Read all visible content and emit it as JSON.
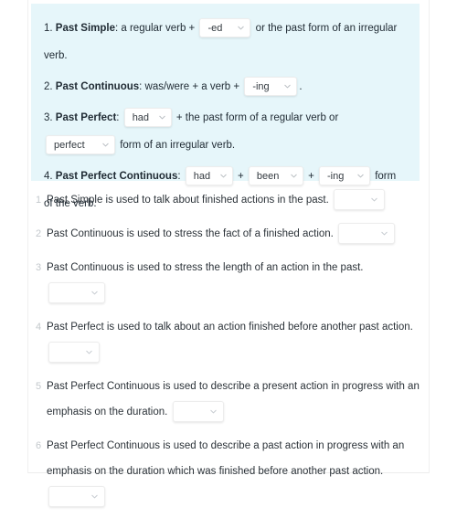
{
  "colors": {
    "panel_bg": "#e6f6fa",
    "page_bg": "#ffffff",
    "text": "#2b3238",
    "number": "#c3c8cc",
    "dropdown_bg": "#ffffff",
    "dropdown_border": "#ededed"
  },
  "rules_panel": {
    "rules": [
      {
        "number": "1.",
        "title": "Past Simple",
        "before": ": a regular verb +",
        "dropdown1_value": "-ed",
        "after": "or the past form of an irregular verb."
      },
      {
        "number": "2.",
        "title": "Past Continuous",
        "before": ": was/were + a verb +",
        "dropdown1_value": "-ing",
        "after": "."
      },
      {
        "number": "3.",
        "title": "Past Perfect",
        "before": ":",
        "dropdown1_value": "had",
        "middle": "+ the past form of a regular verb or",
        "dropdown2_value": "perfect",
        "after": "form of an irregular verb."
      },
      {
        "number": "4.",
        "title": "Past Perfect Continuous",
        "before": ":",
        "dropdown1_value": "had",
        "plus1": "+",
        "dropdown2_value": "been",
        "plus2": "+",
        "dropdown3_value": "-ing",
        "after": "form of the verb."
      }
    ]
  },
  "questions": {
    "items": [
      {
        "number": "1",
        "text": "Past Simple is used to talk about finished actions in the past.",
        "answer_value": "",
        "layout": "inline"
      },
      {
        "number": "2",
        "text": "Past Continuous is used to stress the fact of a finished action.",
        "answer_value": "",
        "layout": "inline"
      },
      {
        "number": "3",
        "text": "Past Continuous is used to stress the length of an action in the past.",
        "answer_value": "",
        "layout": "wrap"
      },
      {
        "number": "4",
        "text": "Past Perfect is used to talk about an action finished before another past action.",
        "answer_value": "",
        "layout": "inline"
      },
      {
        "number": "5",
        "text": "Past Perfect Continuous is used to describe a present action in progress with an emphasis on the duration.",
        "answer_value": "",
        "layout": "inline"
      },
      {
        "number": "6",
        "text": "Past Perfect Continuous is used to describe a past action in progress with an emphasis on the duration which was finished before another past action.",
        "answer_value": "",
        "layout": "wrap"
      }
    ]
  },
  "icons": {
    "chevron_down": "chevron-down-icon"
  }
}
